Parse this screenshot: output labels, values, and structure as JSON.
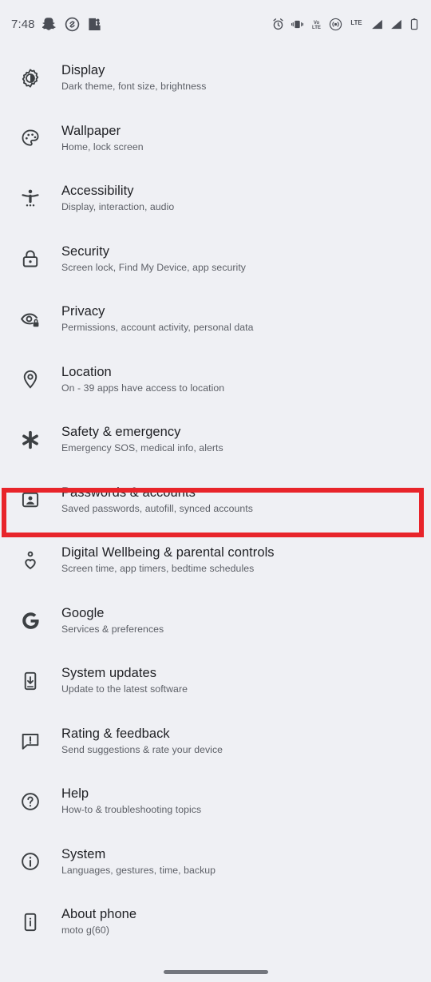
{
  "statusbar": {
    "time": "7:48",
    "left_icons": [
      {
        "name": "snapchat-icon",
        "label": "Snapchat"
      },
      {
        "name": "shazam-icon",
        "label": "Shazam"
      },
      {
        "name": "puzzle-piece-icon",
        "label": "Puzzle piece"
      }
    ],
    "right_icons": [
      {
        "name": "alarm-clock-icon",
        "label": "Alarm set"
      },
      {
        "name": "vibrate-icon",
        "label": "Ringer vibrate"
      },
      {
        "name": "volte-icon",
        "label": "VoLTE",
        "text_top": "Vo",
        "text_bottom": "LTE"
      },
      {
        "name": "wifi-calling-icon",
        "label": "Wi-Fi calling"
      },
      {
        "name": "lte-label-icon",
        "label": "LTE",
        "text": "LTE"
      },
      {
        "name": "signal-bars-sim1-icon",
        "label": "Signal SIM 1"
      },
      {
        "name": "signal-bars-sim2-icon",
        "label": "Signal SIM 2"
      },
      {
        "name": "battery-icon",
        "label": "Battery"
      }
    ]
  },
  "colors": {
    "background": "#eff0f4",
    "title_text": "#1f2024",
    "subtitle_text": "#5d6067",
    "icon": "#3c4043",
    "highlight_border": "#e8242a",
    "gesture_pill": "#73767d"
  },
  "highlight": {
    "target": "Passwords & accounts",
    "color": "#e8242a"
  },
  "settings": {
    "items": [
      {
        "icon": "brightness-icon",
        "title": "Display",
        "subtitle": "Dark theme, font size, brightness"
      },
      {
        "icon": "palette-icon",
        "title": "Wallpaper",
        "subtitle": "Home, lock screen"
      },
      {
        "icon": "accessibility-person-icon",
        "title": "Accessibility",
        "subtitle": "Display, interaction, audio"
      },
      {
        "icon": "lock-icon",
        "title": "Security",
        "subtitle": "Screen lock, Find My Device, app security"
      },
      {
        "icon": "eye-lock-icon",
        "title": "Privacy",
        "subtitle": "Permissions, account activity, personal data"
      },
      {
        "icon": "location-pin-icon",
        "title": "Location",
        "subtitle": "On - 39 apps have access to location"
      },
      {
        "icon": "medical-asterisk-icon",
        "title": "Safety & emergency",
        "subtitle": "Emergency SOS, medical info, alerts"
      },
      {
        "icon": "account-box-icon",
        "title": "Passwords & accounts",
        "subtitle": "Saved passwords, autofill, synced accounts"
      },
      {
        "icon": "person-heart-icon",
        "title": "Digital Wellbeing & parental controls",
        "subtitle": "Screen time, app timers, bedtime schedules"
      },
      {
        "icon": "google-g-icon",
        "title": "Google",
        "subtitle": "Services & preferences"
      },
      {
        "icon": "phone-download-icon",
        "title": "System updates",
        "subtitle": "Update to the latest software"
      },
      {
        "icon": "feedback-bubble-icon",
        "title": "Rating & feedback",
        "subtitle": "Send suggestions & rate your device"
      },
      {
        "icon": "help-circle-icon",
        "title": "Help",
        "subtitle": "How-to & troubleshooting topics"
      },
      {
        "icon": "info-circle-icon",
        "title": "System",
        "subtitle": "Languages, gestures, time, backup"
      },
      {
        "icon": "phone-info-icon",
        "title": "About phone",
        "subtitle": "moto g(60)"
      }
    ]
  },
  "navbar": {
    "gesture_pill": "home-gesture-bar"
  }
}
